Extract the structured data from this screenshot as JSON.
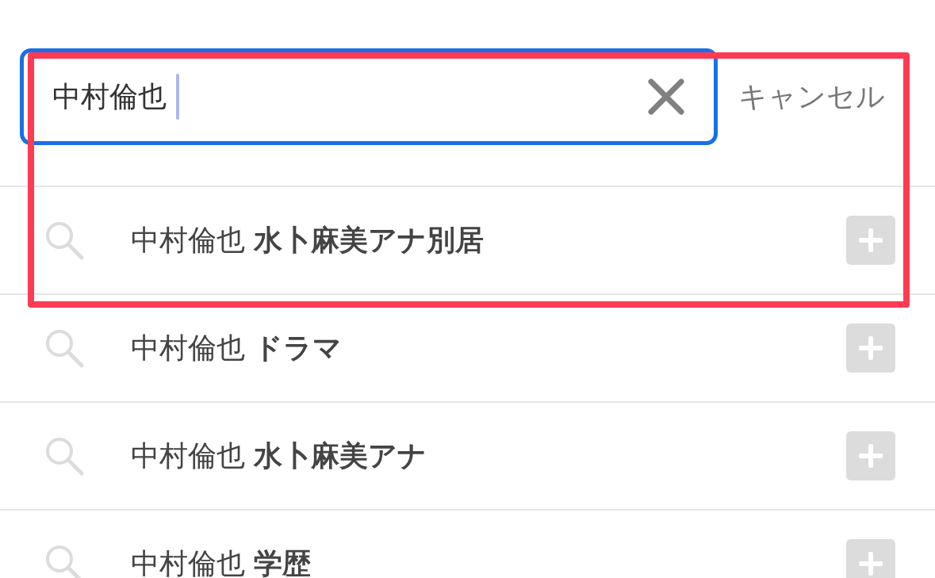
{
  "search": {
    "value": "中村倫也",
    "focused": true
  },
  "cancel_label": "キャンセル",
  "suggestions": [
    {
      "text": "中村倫也 **水卜麻美アナ別居**"
    },
    {
      "text": "中村倫也 **ドラマ**"
    },
    {
      "text": "中村倫也 **水卜麻美アナ**"
    },
    {
      "text": "中村倫也 **学歴**"
    }
  ],
  "highlight_box": true
}
